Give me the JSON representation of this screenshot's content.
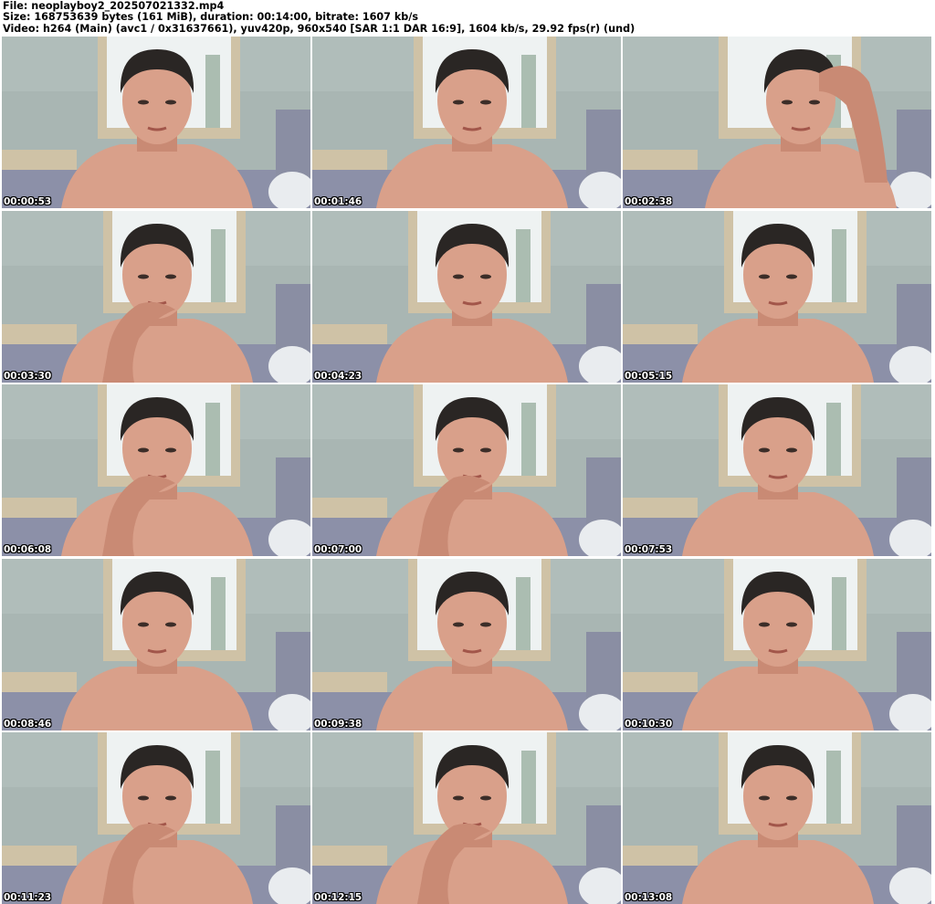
{
  "header": {
    "file_line": "File: neoplayboy2_202507021332.mp4",
    "size_line": "Size: 168753639 bytes (161 MiB), duration: 00:14:00, bitrate: 1607 kb/s",
    "video_line": "Video: h264 (Main) (avc1 / 0x31637661), yuv420p, 960x540 [SAR 1:1 DAR 16:9], 1604 kb/s, 29.92 fps(r) (und)"
  },
  "colors": {
    "wall": "#a9b6b3",
    "wall_light": "#b8c4c2",
    "frame": "#cfc2a6",
    "window": "#eef2f2",
    "skin": "#d9a08a",
    "skin_shadow": "#c98a74",
    "hair": "#2a2624",
    "sofa": "#8c90a8",
    "pillow": "#e9ecef",
    "timestamp_text": "#ffffff"
  },
  "thumbnails": [
    {
      "timestamp": "00:00:53",
      "hand": "none"
    },
    {
      "timestamp": "00:01:46",
      "hand": "none"
    },
    {
      "timestamp": "00:02:38",
      "hand": "head"
    },
    {
      "timestamp": "00:03:30",
      "hand": "chin"
    },
    {
      "timestamp": "00:04:23",
      "hand": "none"
    },
    {
      "timestamp": "00:05:15",
      "hand": "none"
    },
    {
      "timestamp": "00:06:08",
      "hand": "chin"
    },
    {
      "timestamp": "00:07:00",
      "hand": "chin"
    },
    {
      "timestamp": "00:07:53",
      "hand": "none"
    },
    {
      "timestamp": "00:08:46",
      "hand": "none"
    },
    {
      "timestamp": "00:09:38",
      "hand": "none"
    },
    {
      "timestamp": "00:10:30",
      "hand": "none"
    },
    {
      "timestamp": "00:11:23",
      "hand": "chin"
    },
    {
      "timestamp": "00:12:15",
      "hand": "chin"
    },
    {
      "timestamp": "00:13:08",
      "hand": "none"
    }
  ]
}
